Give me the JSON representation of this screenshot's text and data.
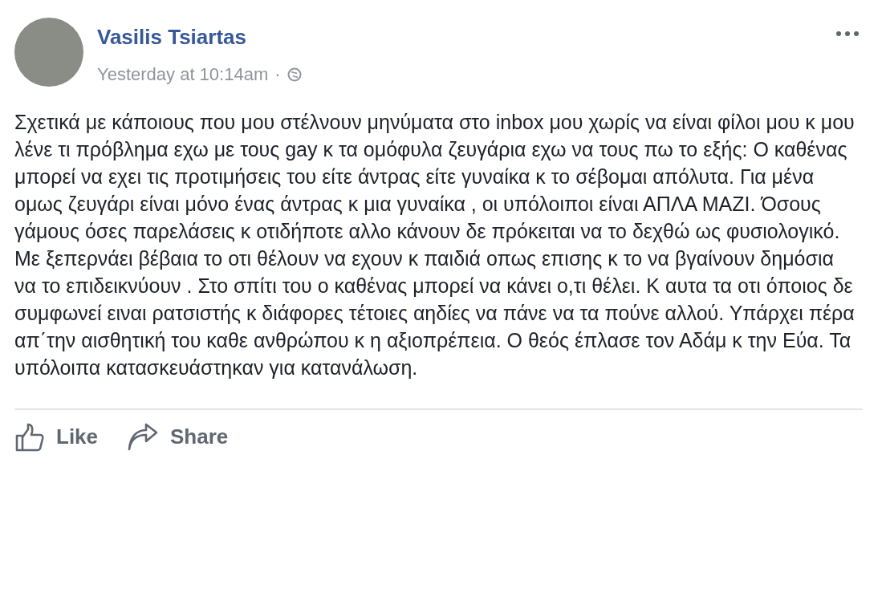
{
  "post": {
    "author": "Vasilis Tsiartas",
    "timestamp": "Yesterday at 10:14am",
    "separator": "·",
    "body": "Σχετικά με κάποιους που μου στέλνουν μηνύματα στο inbox μου χωρίς να είναι φίλοι μου κ μου λένε τι πρόβλημα εχω με τους gay κ τα ομόφυλα ζευγάρια εχω να τους πω το εξής: Ο καθένας μπορεί να εχει τις προτιμήσεις του είτε άντρας είτε γυναίκα κ το σέβομαι απόλυτα. Για μένα ομως ζευγάρι είναι μόνο ένας άντρας κ μια γυναίκα , οι υπόλοιποι είναι ΑΠΛΑ ΜΑΖΙ. Όσους γάμους όσες παρελάσεις κ οτιδήποτε αλλο κάνουν δε πρόκειται να το δεχθώ ως φυσιολογικό. Με ξεπερνάει βέβαια το οτι θέλουν να εχουν κ παιδιά οπως επισης κ το να βγαίνουν δημόσια να το επιδεικνύουν . Στο σπίτι του ο καθένας μπορεί να κάνει ο,τι θέλει. Κ αυτα τα οτι όποιος δε συμφωνεί ειναι ρατσιστής κ διάφορες τέτοιες αηδίες να πάνε να τα πούνε αλλού. Υπάρχει πέρα απ΄την αισθητική του καθε ανθρώπου κ η αξιοπρέπεια. Ο θεός έπλασε τον Αδάμ κ την Εύα. Τα υπόλοιπα κατασκευάστηκαν για κατανάλωση."
  },
  "actions": [
    {
      "kind": "like",
      "label": "Like"
    },
    {
      "kind": "share",
      "label": "Share"
    }
  ]
}
